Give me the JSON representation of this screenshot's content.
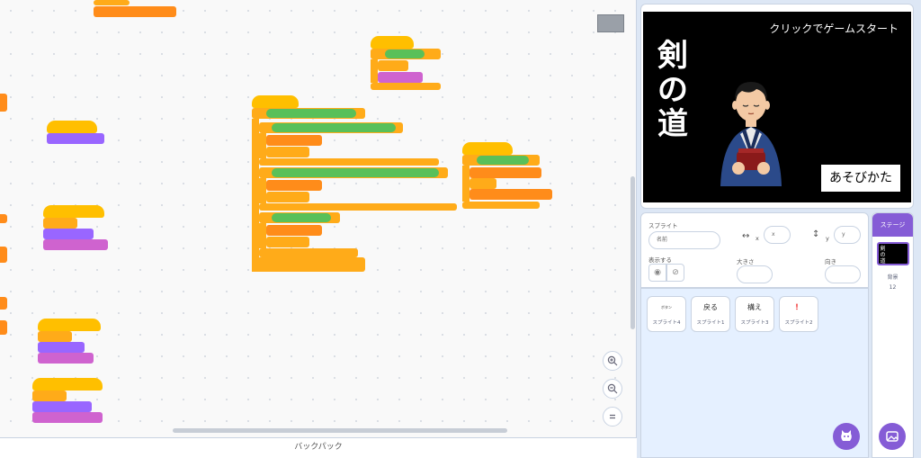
{
  "backpack_label": "バックパック",
  "stage": {
    "title_text": "クリックでゲームスタート",
    "kanji": "剣の道",
    "howto_button": "あそびかた"
  },
  "sprite_info": {
    "sprite_label": "スプライト",
    "name_placeholder": "名前",
    "x_label": "x",
    "x_placeholder": "x",
    "y_label": "y",
    "y_placeholder": "y",
    "show_label": "表示する",
    "size_label": "大きさ",
    "direction_label": "向き"
  },
  "sprites": [
    {
      "name": "スプライト4",
      "thumb": "ボタン"
    },
    {
      "name": "スプライト1",
      "thumb": "戻る"
    },
    {
      "name": "スプライト3",
      "thumb": "構え"
    },
    {
      "name": "スプライト2",
      "thumb": "！"
    }
  ],
  "stage_panel": {
    "title": "ステージ",
    "backdrop_label": "背景",
    "backdrop_count": "12"
  },
  "colors": {
    "accent": "#855cd6",
    "control": "#ffab19",
    "events": "#ffbf00",
    "looks": "#9966ff",
    "operators": "#59c059",
    "variables": "#ff8c1a"
  }
}
